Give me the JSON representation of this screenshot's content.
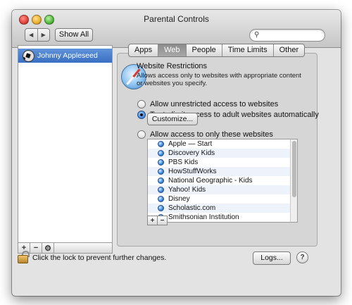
{
  "window": {
    "title": "Parental Controls"
  },
  "toolbar": {
    "back_icon": "chevron-left-icon",
    "forward_icon": "chevron-right-icon",
    "show_all_label": "Show All",
    "search_value": "",
    "search_placeholder": ""
  },
  "sidebar": {
    "accounts": [
      {
        "name": "Johnny Appleseed",
        "icon": "soccer-ball-icon",
        "selected": true
      }
    ],
    "buttons": {
      "add": "+",
      "remove": "−",
      "action_icon": "gear-icon"
    }
  },
  "tabs": [
    {
      "label": "Apps",
      "active": false
    },
    {
      "label": "Web",
      "active": true
    },
    {
      "label": "People",
      "active": false
    },
    {
      "label": "Time Limits",
      "active": false
    },
    {
      "label": "Other",
      "active": false
    }
  ],
  "web": {
    "heading": "Website Restrictions",
    "description": "Allows access only to websites with appropriate content or websites you specify.",
    "options": [
      {
        "label": "Allow unrestricted access to websites",
        "selected": false
      },
      {
        "label": "Try to limit access to adult websites automatically",
        "selected": true
      },
      {
        "label": "Allow access to only these websites",
        "selected": false
      }
    ],
    "customize_label": "Customize...",
    "sites": [
      "Apple — Start",
      "Discovery Kids",
      "PBS Kids",
      "HowStuffWorks",
      "National Geographic - Kids",
      "Yahoo! Kids",
      "Disney",
      "Scholastic.com",
      "Smithsonian Institution"
    ],
    "list_buttons": {
      "add": "+",
      "remove": "−"
    }
  },
  "footer": {
    "lock_text": "Click the lock to prevent further changes.",
    "logs_label": "Logs...",
    "help_label": "?"
  }
}
